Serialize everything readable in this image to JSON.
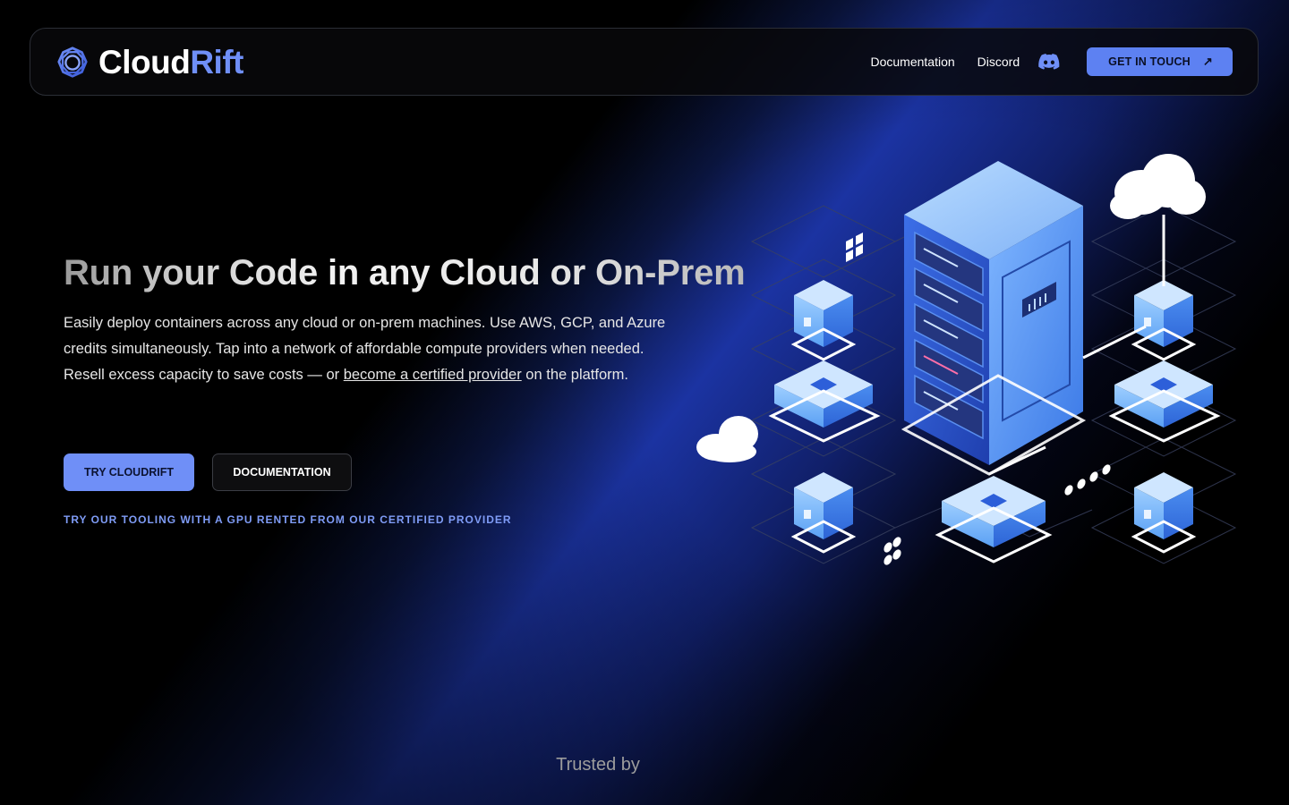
{
  "nav": {
    "logo_text_main": "Cloud",
    "logo_text_accent": "Rift",
    "logo_icon": "cloudrift-logo-icon",
    "links": [
      {
        "label": "Documentation"
      },
      {
        "label": "Discord"
      }
    ],
    "discord_icon": "discord-icon",
    "cta_label": "GET IN TOUCH",
    "cta_icon": "arrow-up-right-icon"
  },
  "hero": {
    "title": "Run your Code in any Cloud or On-Prem",
    "desc_part1": "Easily deploy containers across any cloud or on-prem machines. Use AWS, GCP, and Azure credits simultaneously. Tap into a network of affordable compute providers when needed. Resell excess capacity to save costs — or ",
    "desc_link": "become a certified provider",
    "desc_part2": " on the platform.",
    "primary_button": "TRY CLOUDRIFT",
    "secondary_button": "DOCUMENTATION",
    "tooling_link": "TRY OUR TOOLING WITH A GPU RENTED FROM OUR CERTIFIED PROVIDER"
  },
  "trusted": {
    "label": "Trusted by"
  },
  "colors": {
    "accent": "#6f8ff7",
    "background": "#000000",
    "glow": "#2040c0"
  }
}
